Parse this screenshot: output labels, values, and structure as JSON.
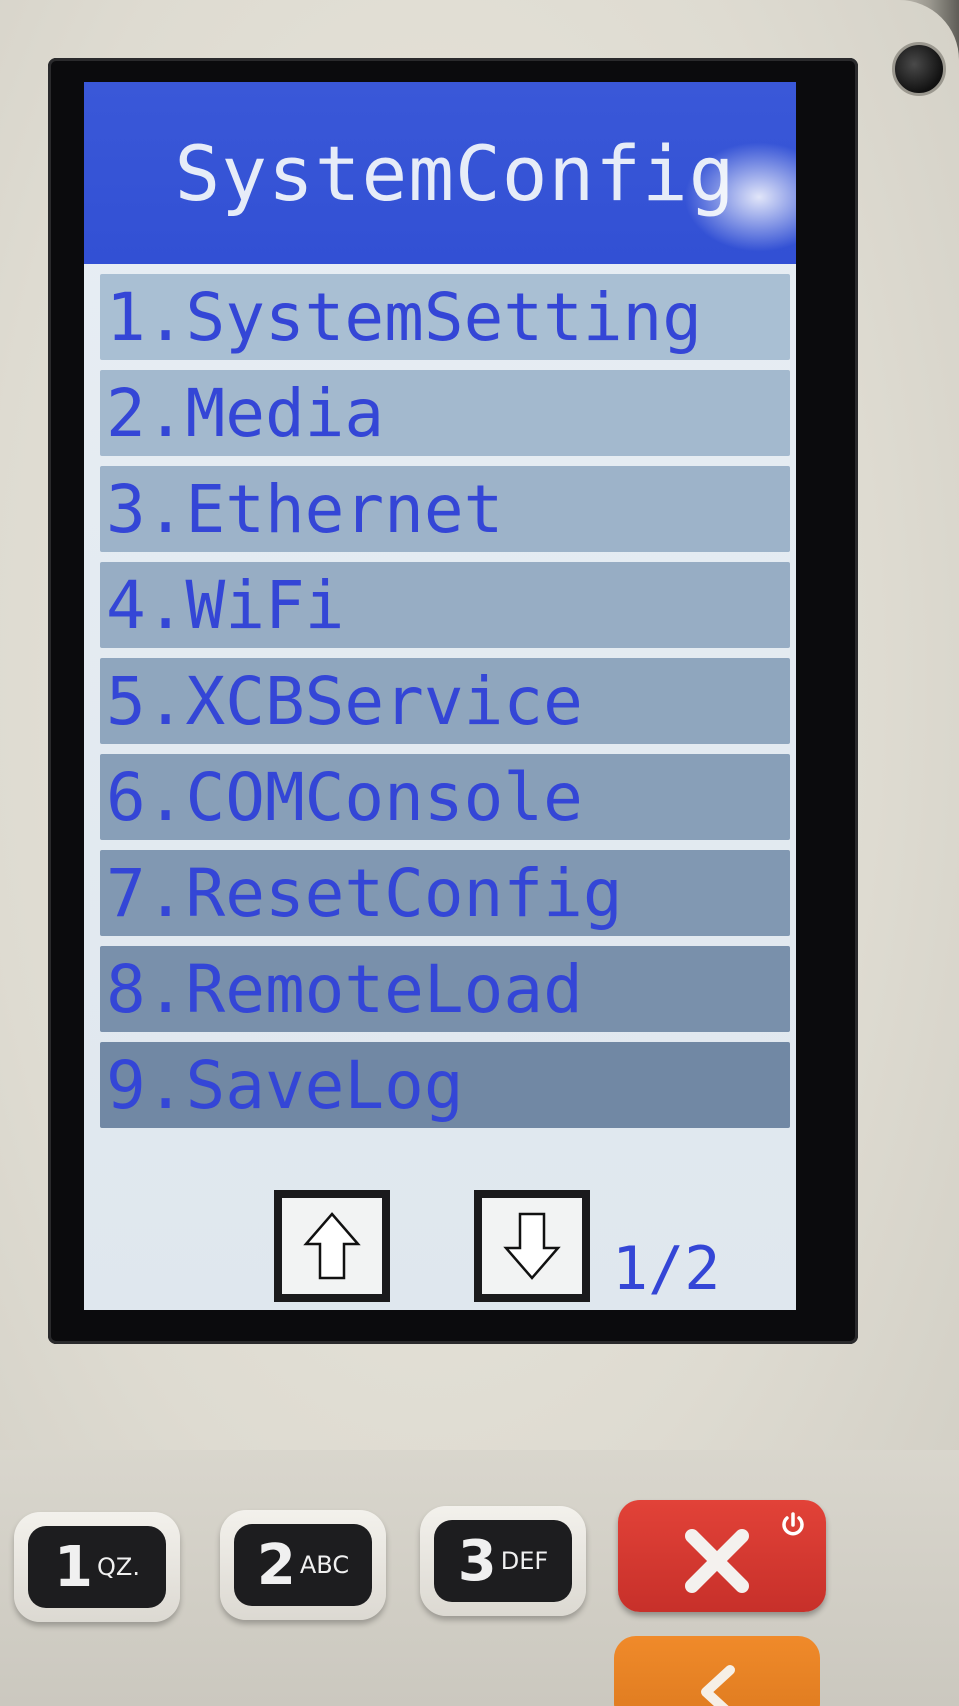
{
  "screen": {
    "title": "SystemConfig",
    "menu_items": [
      {
        "label": "1.SystemSetting",
        "bg": "#a9bfd3"
      },
      {
        "label": "2.Media",
        "bg": "#a3b9ce"
      },
      {
        "label": "3.Ethernet",
        "bg": "#9db3c9"
      },
      {
        "label": "4.WiFi",
        "bg": "#97adc4"
      },
      {
        "label": "5.XCBService",
        "bg": "#8fa6be"
      },
      {
        "label": "6.COMConsole",
        "bg": "#889fb8"
      },
      {
        "label": "7.ResetConfig",
        "bg": "#8198b2"
      },
      {
        "label": "8.RemoteLoad",
        "bg": "#7990ab"
      },
      {
        "label": "9.SaveLog",
        "bg": "#7188a4"
      }
    ],
    "nav": {
      "up_icon": "arrow-up-icon",
      "down_icon": "arrow-down-icon",
      "page_indicator": "1/2"
    }
  },
  "keypad": {
    "keys": [
      {
        "digit": "1",
        "letters": "QZ."
      },
      {
        "digit": "2",
        "letters": "ABC"
      },
      {
        "digit": "3",
        "letters": "DEF"
      }
    ],
    "cancel_icon": "cancel-x-icon",
    "power_icon": "power-icon",
    "clear_icon": "clear-icon"
  },
  "colors": {
    "title_bar": "#3250d4",
    "menu_text": "#3446d6",
    "cancel_key": "#d6382f",
    "clear_key": "#e8821f"
  }
}
